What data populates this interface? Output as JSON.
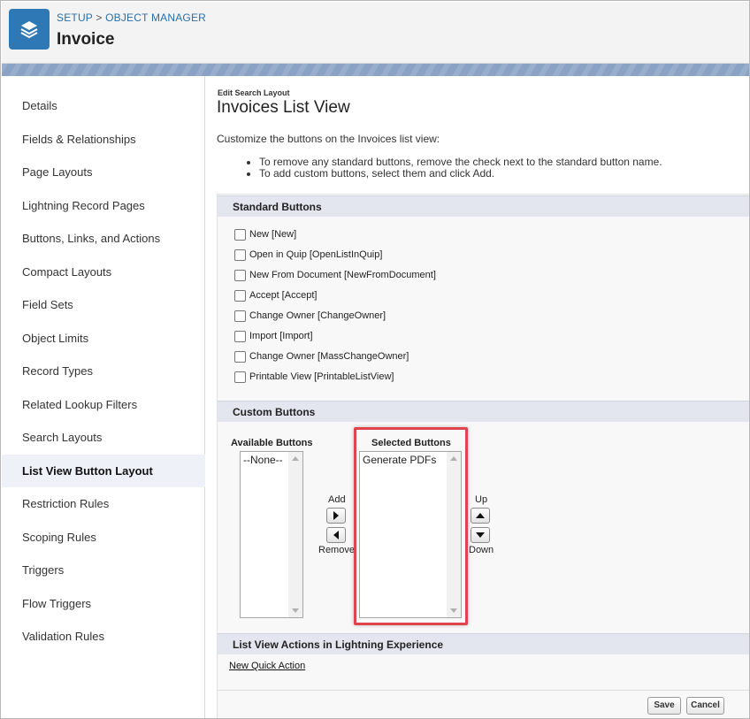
{
  "header": {
    "breadcrumb_setup": "SETUP",
    "breadcrumb_sep": ">",
    "breadcrumb_object_manager": "OBJECT MANAGER",
    "title": "Invoice",
    "icon": "layers-icon"
  },
  "sidebar": {
    "items": [
      {
        "label": "Details"
      },
      {
        "label": "Fields & Relationships"
      },
      {
        "label": "Page Layouts"
      },
      {
        "label": "Lightning Record Pages"
      },
      {
        "label": "Buttons, Links, and Actions"
      },
      {
        "label": "Compact Layouts"
      },
      {
        "label": "Field Sets"
      },
      {
        "label": "Object Limits"
      },
      {
        "label": "Record Types"
      },
      {
        "label": "Related Lookup Filters"
      },
      {
        "label": "Search Layouts"
      },
      {
        "label": "List View Button Layout"
      },
      {
        "label": "Restriction Rules"
      },
      {
        "label": "Scoping Rules"
      },
      {
        "label": "Triggers"
      },
      {
        "label": "Flow Triggers"
      },
      {
        "label": "Validation Rules"
      }
    ],
    "active": "List View Button Layout"
  },
  "main": {
    "sub_label": "Edit Search Layout",
    "title": "Invoices List View",
    "intro": "Customize the buttons on the Invoices list view:",
    "bullets": [
      "To remove any standard buttons, remove the check next to the standard button name.",
      "To add custom buttons, select them and click Add."
    ],
    "standard_buttons": {
      "heading": "Standard Buttons",
      "items": [
        {
          "label": "New [New]",
          "checked": false
        },
        {
          "label": "Open in Quip [OpenListInQuip]",
          "checked": false
        },
        {
          "label": "New From Document [NewFromDocument]",
          "checked": false
        },
        {
          "label": "Accept [Accept]",
          "checked": false
        },
        {
          "label": "Change Owner [ChangeOwner]",
          "checked": false
        },
        {
          "label": "Import [Import]",
          "checked": false
        },
        {
          "label": "Change Owner [MassChangeOwner]",
          "checked": false
        },
        {
          "label": "Printable View [PrintableListView]",
          "checked": false
        }
      ]
    },
    "custom_buttons": {
      "heading": "Custom Buttons",
      "available_label": "Available Buttons",
      "available_options": [
        "--None--"
      ],
      "selected_label": "Selected Buttons",
      "selected_options": [
        "Generate PDFs"
      ],
      "add_label": "Add",
      "remove_label": "Remove",
      "up_label": "Up",
      "down_label": "Down"
    },
    "lightning_actions": {
      "heading": "List View Actions in Lightning Experience",
      "link": "New Quick Action"
    },
    "save_label": "Save",
    "cancel_label": "Cancel"
  },
  "colors": {
    "accent": "#2e79b5",
    "highlight": "#e0434b"
  }
}
